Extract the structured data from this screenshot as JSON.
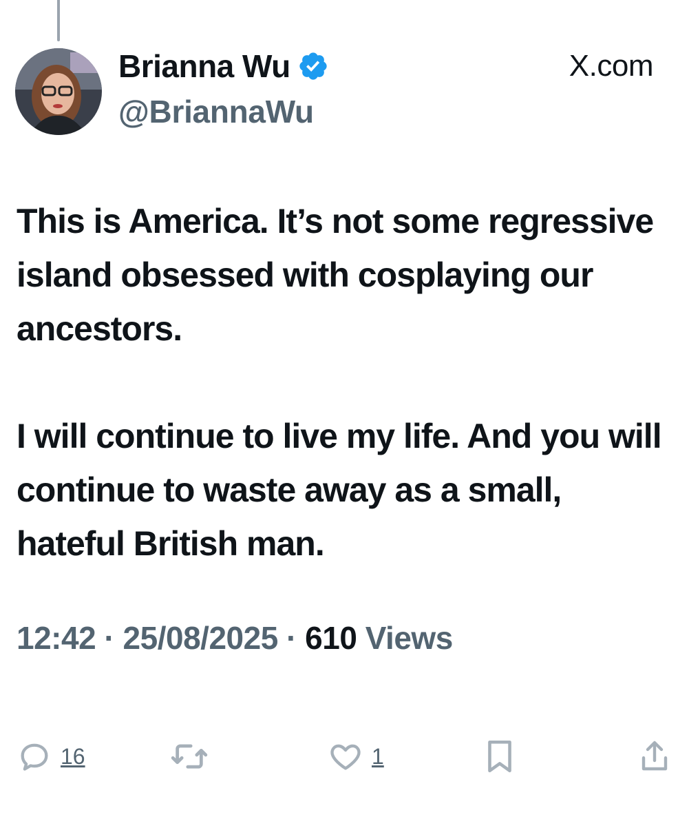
{
  "author": {
    "name": "Brianna Wu",
    "handle": "@BriannaWu",
    "verified": true
  },
  "source_label": "X.com",
  "tweet": {
    "paragraphs": [
      "This is America. It’s not some regressive island obsessed with cosplaying our ancestors.",
      "I will continue to live my life. And you will continue to waste away as a small, hateful British man."
    ]
  },
  "meta": {
    "time": "12:42",
    "separator": " · ",
    "date": "25/08/2025",
    "views_count": "610",
    "views_label": " Views"
  },
  "actions": {
    "replies": "16",
    "likes": "1"
  },
  "colors": {
    "text": "#0f1419",
    "secondary": "#536471",
    "verified": "#1d9bf0",
    "thread_line": "#9aa4ae"
  },
  "icons": [
    "verified-icon",
    "reply-icon",
    "retweet-icon",
    "like-icon",
    "bookmark-icon",
    "share-icon"
  ]
}
